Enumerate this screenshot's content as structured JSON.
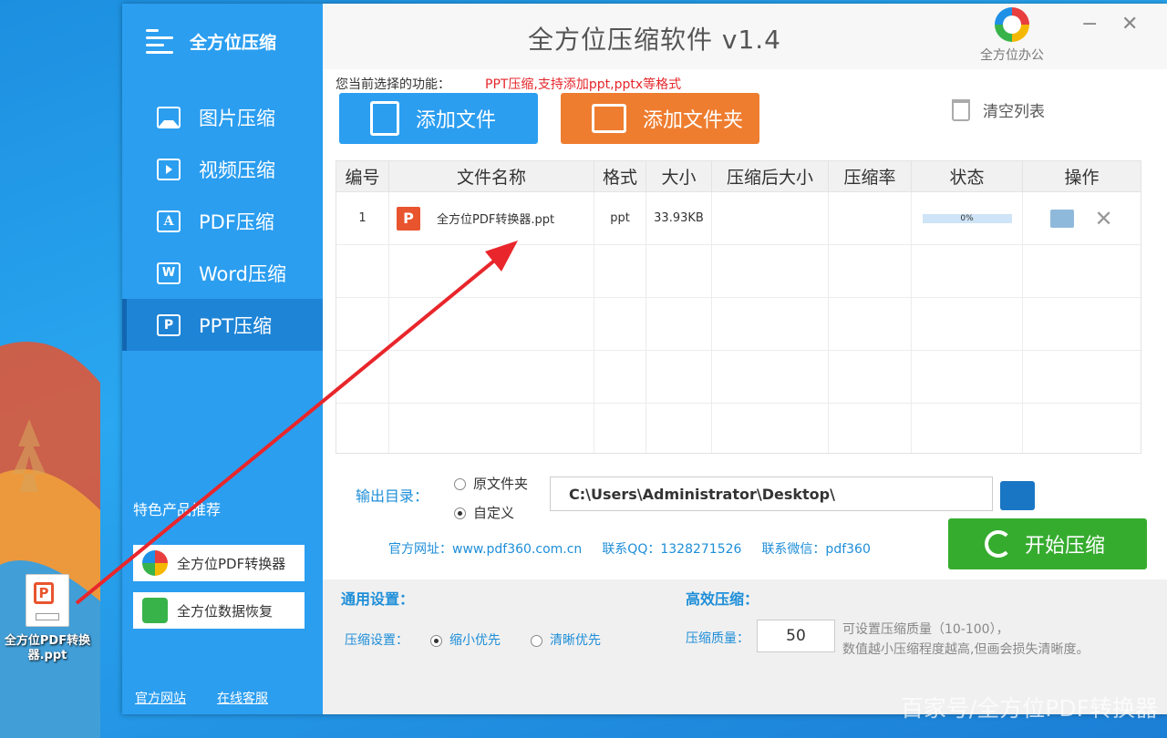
{
  "desktop": {
    "file_icon_name": "全方位PDF转换器.ppt"
  },
  "sidebar": {
    "logo": "全方位压缩",
    "items": [
      {
        "label": "图片压缩",
        "icon": "image-icon"
      },
      {
        "label": "视频压缩",
        "icon": "video-icon"
      },
      {
        "label": "PDF压缩",
        "icon": "pdf-icon"
      },
      {
        "label": "Word压缩",
        "icon": "word-icon"
      },
      {
        "label": "PPT压缩",
        "icon": "ppt-icon",
        "active": true
      }
    ],
    "promo_title": "特色产品推荐",
    "promo_items": [
      {
        "label": "全方位PDF转换器"
      },
      {
        "label": "全方位数据恢复"
      }
    ],
    "footer_links": [
      "官方网站",
      "在线客服"
    ]
  },
  "titlebar": {
    "title": "全方位压缩软件 v1.4",
    "brand": "全方位办公",
    "minimize": "−",
    "close": "✕"
  },
  "toolbar": {
    "func_label": "您当前选择的功能：",
    "func_value": "PPT压缩,支持添加ppt,pptx等格式",
    "add_file": "添加文件",
    "add_folder": "添加文件夹",
    "clear_list": "清空列表"
  },
  "table": {
    "headers": [
      "编号",
      "文件名称",
      "格式",
      "大小",
      "压缩后大小",
      "压缩率",
      "状态",
      "操作"
    ],
    "rows": [
      {
        "index": "1",
        "name": "全方位PDF转换器.ppt",
        "format": "ppt",
        "size": "33.93KB",
        "compressed": "",
        "ratio": "",
        "status": "0%"
      }
    ]
  },
  "output": {
    "label": "输出目录：",
    "option_original": "原文件夹",
    "option_custom": "自定义",
    "path": "C:\\Users\\Administrator\\Desktop\\",
    "start": "开始压缩"
  },
  "contact": {
    "website": "官方网址：www.pdf360.com.cn",
    "qq": "联系QQ：1328271526",
    "wechat": "联系微信：pdf360"
  },
  "settings": {
    "general_title": "通用设置：",
    "compress_label": "压缩设置：",
    "option_small": "缩小优先",
    "option_clear": "清晰优先",
    "efficient_title": "高效压缩：",
    "quality_label": "压缩质量：",
    "quality_value": "50",
    "tip_line1": "可设置压缩质量（10-100），",
    "tip_line2": "数值越小压缩程度越高,但画会损失清晰度。"
  },
  "watermark": "百家号/全方位PDF转换器",
  "colors": {
    "sidebar": "#2b9ef0",
    "add_file_btn": "#2b9ef0",
    "add_folder_btn": "#ee7d2f",
    "start_btn": "#36ac2f",
    "accent_text": "#1e8ed8",
    "func_value": "#e5262b"
  }
}
